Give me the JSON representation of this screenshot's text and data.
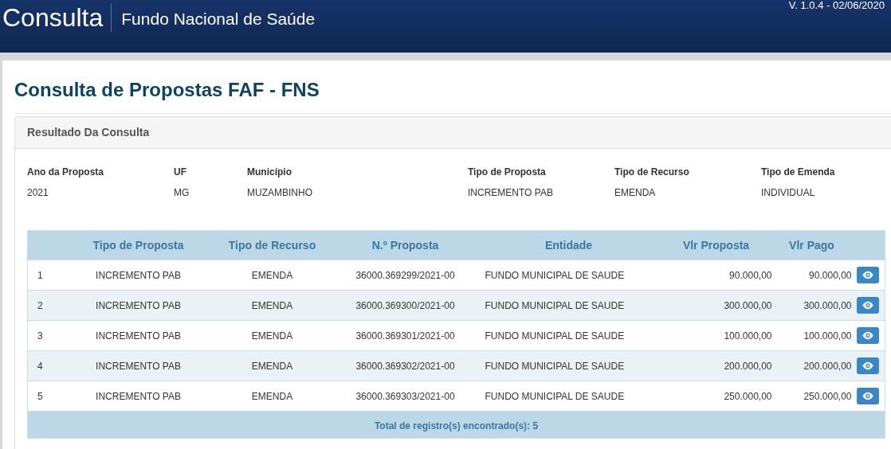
{
  "header": {
    "app_title": "Consulta",
    "subtitle": "Fundo Nacional de Saúde",
    "version": "V. 1.0.4 - 02/06/2020"
  },
  "page_title": "Consulta de Propostas FAF - FNS",
  "panel": {
    "title": "Resultado Da Consulta",
    "fields": [
      {
        "label": "Ano da Proposta",
        "value": "2021"
      },
      {
        "label": "UF",
        "value": "MG"
      },
      {
        "label": "Município",
        "value": "MUZAMBINHO"
      },
      {
        "label": "Tipo de Proposta",
        "value": "INCREMENTO PAB"
      },
      {
        "label": "Tipo de Recurso",
        "value": "EMENDA"
      },
      {
        "label": "Tipo de Emenda",
        "value": "INDIVIDUAL"
      }
    ],
    "table": {
      "columns": [
        "Tipo de Proposta",
        "Tipo de Recurso",
        "N.º Proposta",
        "Entidade",
        "Vlr Proposta",
        "Vlr Pago"
      ],
      "rows": [
        {
          "index": "1",
          "tipo_proposta": "INCREMENTO PAB",
          "tipo_recurso": "EMENDA",
          "numero": "36000.369299/2021-00",
          "entidade": "FUNDO MUNICIPAL DE SAUDE",
          "vlr_proposta": "90.000,00",
          "vlr_pago": "90.000,00"
        },
        {
          "index": "2",
          "tipo_proposta": "INCREMENTO PAB",
          "tipo_recurso": "EMENDA",
          "numero": "36000.369300/2021-00",
          "entidade": "FUNDO MUNICIPAL DE SAUDE",
          "vlr_proposta": "300.000,00",
          "vlr_pago": "300.000,00"
        },
        {
          "index": "3",
          "tipo_proposta": "INCREMENTO PAB",
          "tipo_recurso": "EMENDA",
          "numero": "36000.369301/2021-00",
          "entidade": "FUNDO MUNICIPAL DE SAUDE",
          "vlr_proposta": "100.000,00",
          "vlr_pago": "100.000,00"
        },
        {
          "index": "4",
          "tipo_proposta": "INCREMENTO PAB",
          "tipo_recurso": "EMENDA",
          "numero": "36000.369302/2021-00",
          "entidade": "FUNDO MUNICIPAL DE SAUDE",
          "vlr_proposta": "200.000,00",
          "vlr_pago": "200.000,00"
        },
        {
          "index": "5",
          "tipo_proposta": "INCREMENTO PAB",
          "tipo_recurso": "EMENDA",
          "numero": "36000.369303/2021-00",
          "entidade": "FUNDO MUNICIPAL DE SAUDE",
          "vlr_proposta": "250.000,00",
          "vlr_pago": "250.000,00"
        }
      ],
      "footer": "Total de registro(s) encontrado(s): 5"
    }
  }
}
